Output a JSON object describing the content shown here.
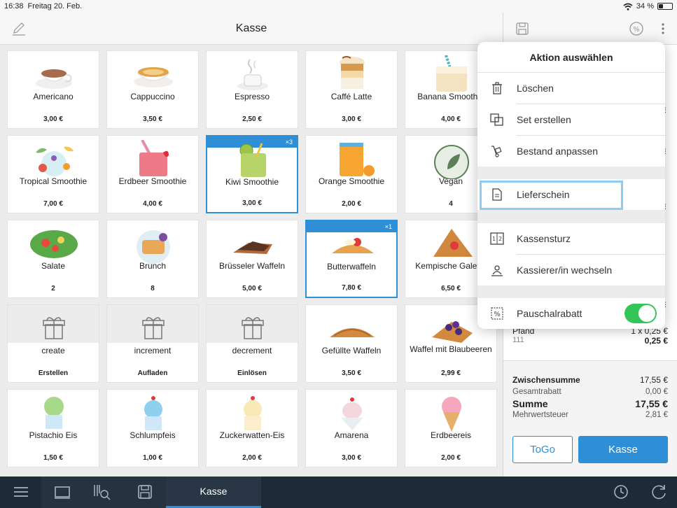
{
  "status": {
    "time": "16:38",
    "date": "Freitag 20. Feb.",
    "battery": "34 %",
    "battery_level": 0.34
  },
  "header": {
    "title": "Kasse"
  },
  "products": [
    {
      "name": "Americano",
      "price": "3,00 €"
    },
    {
      "name": "Cappuccino",
      "price": "3,50 €"
    },
    {
      "name": "Espresso",
      "price": "2,50 €"
    },
    {
      "name": "Caffé Latte",
      "price": "3,00 €"
    },
    {
      "name": "Banana Smoothie",
      "price": "4,00 €"
    },
    {
      "name": "Tropical Smoothie",
      "price": "7,00 €"
    },
    {
      "name": "Erdbeer Smoothie",
      "price": "4,00 €"
    },
    {
      "name": "Kiwi Smoothie",
      "price": "3,00 €",
      "badge": "×3"
    },
    {
      "name": "Orange Smoothie",
      "price": "2,00 €"
    },
    {
      "name": "Vegan",
      "price": "4"
    },
    {
      "name": "Salate",
      "price": "2"
    },
    {
      "name": "Brunch",
      "price": "8"
    },
    {
      "name": "Brüsseler Waffeln",
      "price": "5,00 €"
    },
    {
      "name": "Butterwaffeln",
      "price": "7,80 €",
      "badge": "×1"
    },
    {
      "name": "Kempische Galette",
      "price": "6,50 €"
    },
    {
      "name": "create",
      "price": "Erstellen"
    },
    {
      "name": "increment",
      "price": "Aufladen"
    },
    {
      "name": "decrement",
      "price": "Einlösen"
    },
    {
      "name": "Gefüllte Waffeln",
      "price": "3,50 €"
    },
    {
      "name": "Waffel mit Blaubeeren",
      "price": "2,99 €"
    },
    {
      "name": "Pistachio Eis",
      "price": "1,50 €"
    },
    {
      "name": "Schlumpfeis",
      "price": "1,00 €"
    },
    {
      "name": "Zuckerwatten-Eis",
      "price": "2,00 €"
    },
    {
      "name": "Amarena",
      "price": "3,00 €"
    },
    {
      "name": "Erdbeereis",
      "price": "2,00 €"
    }
  ],
  "popover": {
    "title": "Aktion auswählen",
    "items": {
      "delete": "Löschen",
      "set": "Set erstellen",
      "stock": "Bestand anpassen",
      "delivery": "Lieferschein",
      "cashcount": "Kassensturz",
      "cashier": "Kassierer/in wechseln",
      "discount": "Pauschalrabatt"
    }
  },
  "cart": {
    "pfand_label": "Pfand",
    "pfand_qty": "1 x 0,25 €",
    "pfand_code": "111",
    "pfand_total": "0,25 €"
  },
  "totals": {
    "subtotal_label": "Zwischensumme",
    "subtotal": "17,55 €",
    "discount_label": "Gesamtrabatt",
    "discount": "0,00 €",
    "sum_label": "Summe",
    "sum": "17,55 €",
    "tax_label": "Mehrwertsteuer",
    "tax": "2,81 €"
  },
  "buttons": {
    "togo": "ToGo",
    "kasse": "Kasse"
  },
  "bottombar": {
    "kasse_tab": "Kasse"
  }
}
